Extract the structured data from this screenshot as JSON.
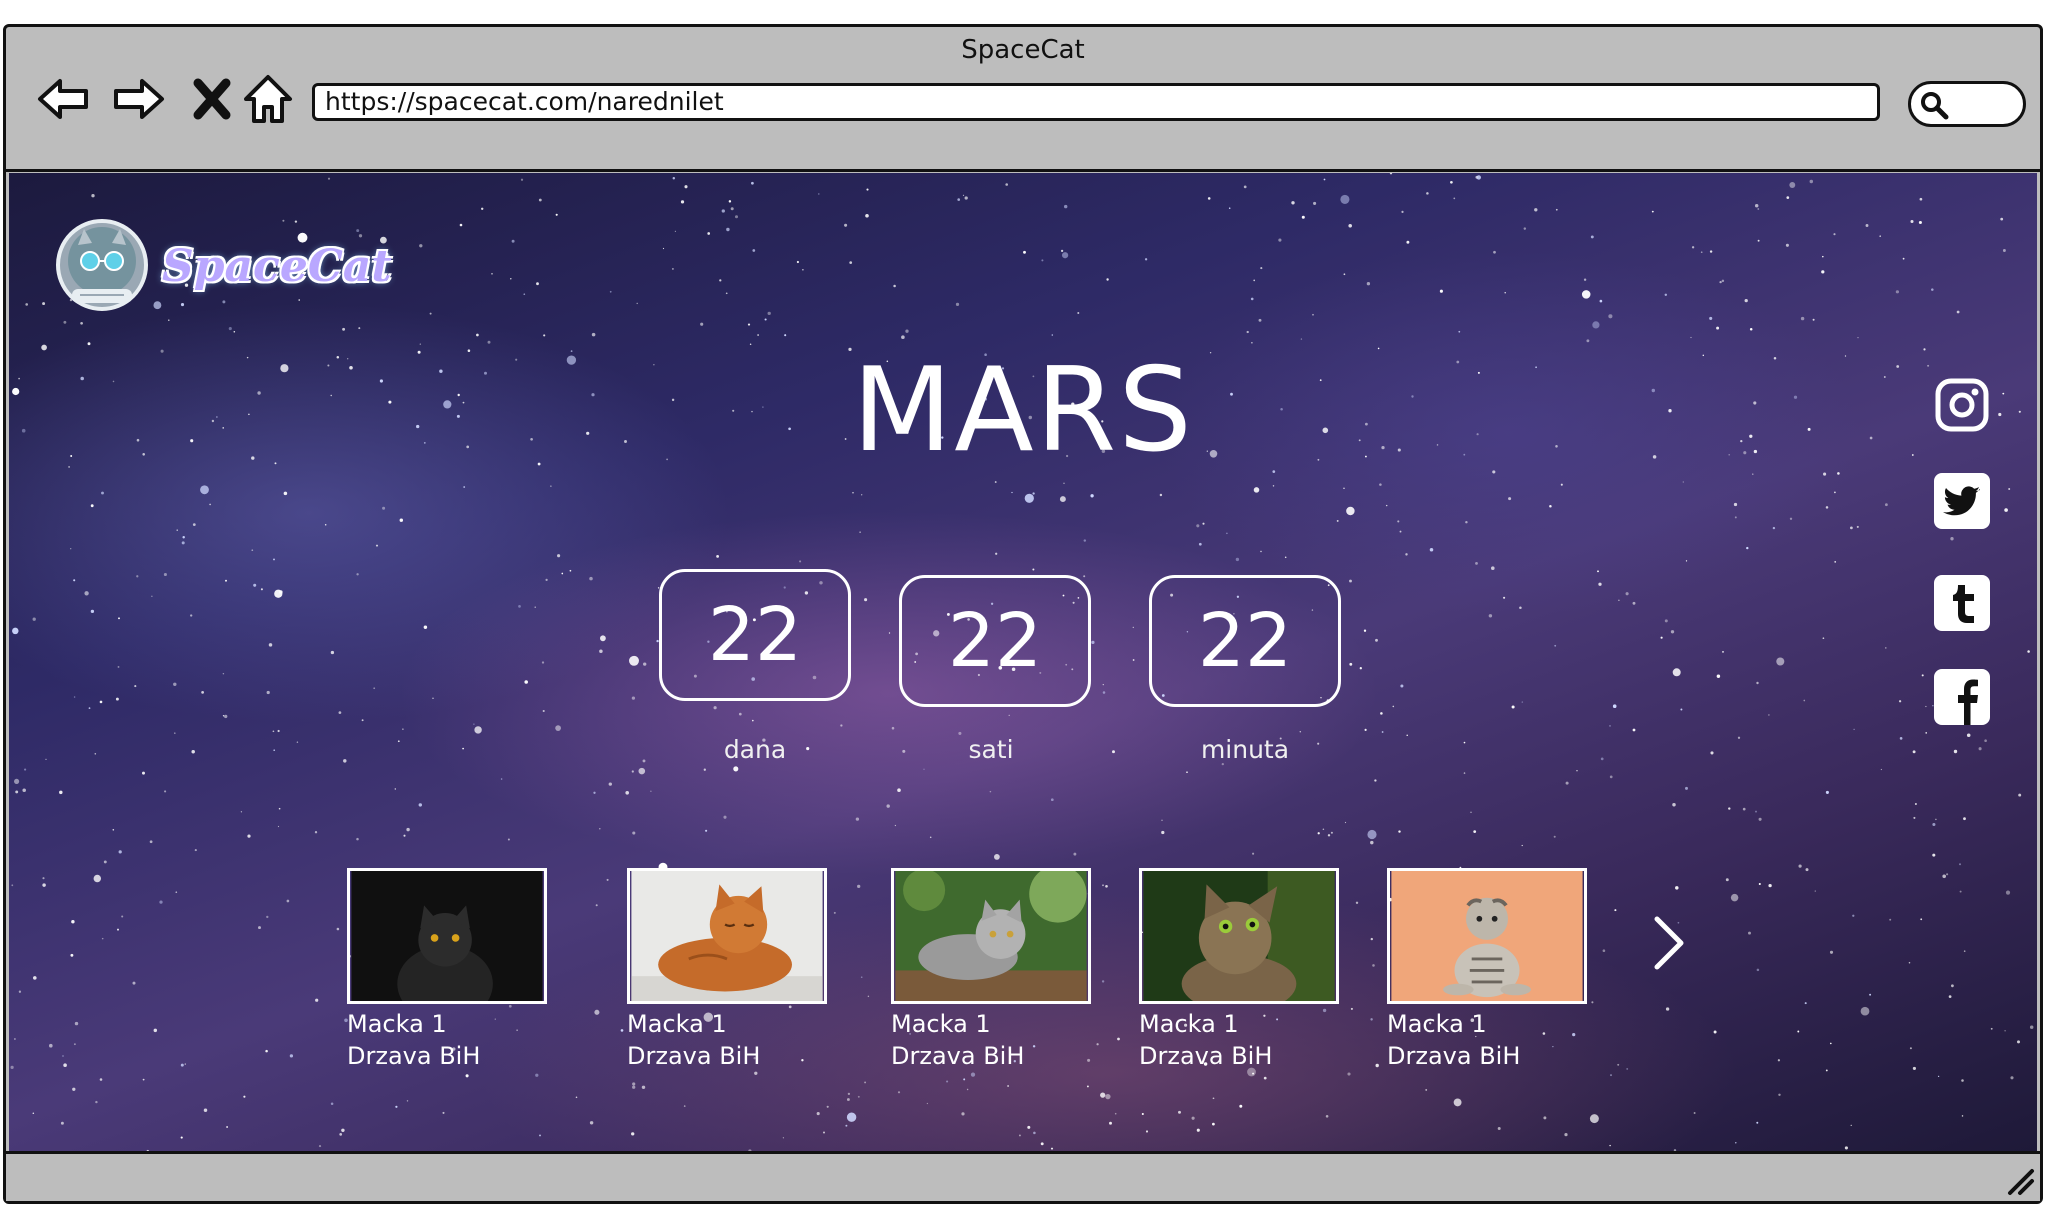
{
  "browser": {
    "title": "SpaceCat",
    "url": "https://spacecat.com/narednilet",
    "nav_icons": [
      "back-arrow-icon",
      "forward-arrow-icon",
      "close-icon",
      "home-icon"
    ],
    "search_icon": "search-icon"
  },
  "site": {
    "logo_text": "SpaceCat",
    "logo_icon": "astronaut-cat-icon"
  },
  "hero": {
    "title": "MARS",
    "countdown": [
      {
        "value": "22",
        "label": "dana"
      },
      {
        "value": "22",
        "label": "sati"
      },
      {
        "value": "22",
        "label": "minuta"
      }
    ]
  },
  "social": [
    {
      "name": "instagram-icon"
    },
    {
      "name": "twitter-icon"
    },
    {
      "name": "tumblr-icon"
    },
    {
      "name": "facebook-icon"
    }
  ],
  "cats": [
    {
      "name": "Macka 1",
      "country": "Drzava BiH",
      "photo": "black-cat"
    },
    {
      "name": "Macka 1",
      "country": "Drzava BiH",
      "photo": "orange-tabby-cat"
    },
    {
      "name": "Macka 1",
      "country": "Drzava BiH",
      "photo": "grey-tabby-cat"
    },
    {
      "name": "Macka 1",
      "country": "Drzava BiH",
      "photo": "tabby-cat-looking-up"
    },
    {
      "name": "Macka 1",
      "country": "Drzava BiH",
      "photo": "scottish-fold-sitting"
    }
  ],
  "carousel": {
    "next_icon": "chevron-right-icon"
  },
  "colors": {
    "chrome": "#bdbdbd",
    "text_on_space": "#ffffff",
    "logo_text": "#b9a7ff"
  }
}
